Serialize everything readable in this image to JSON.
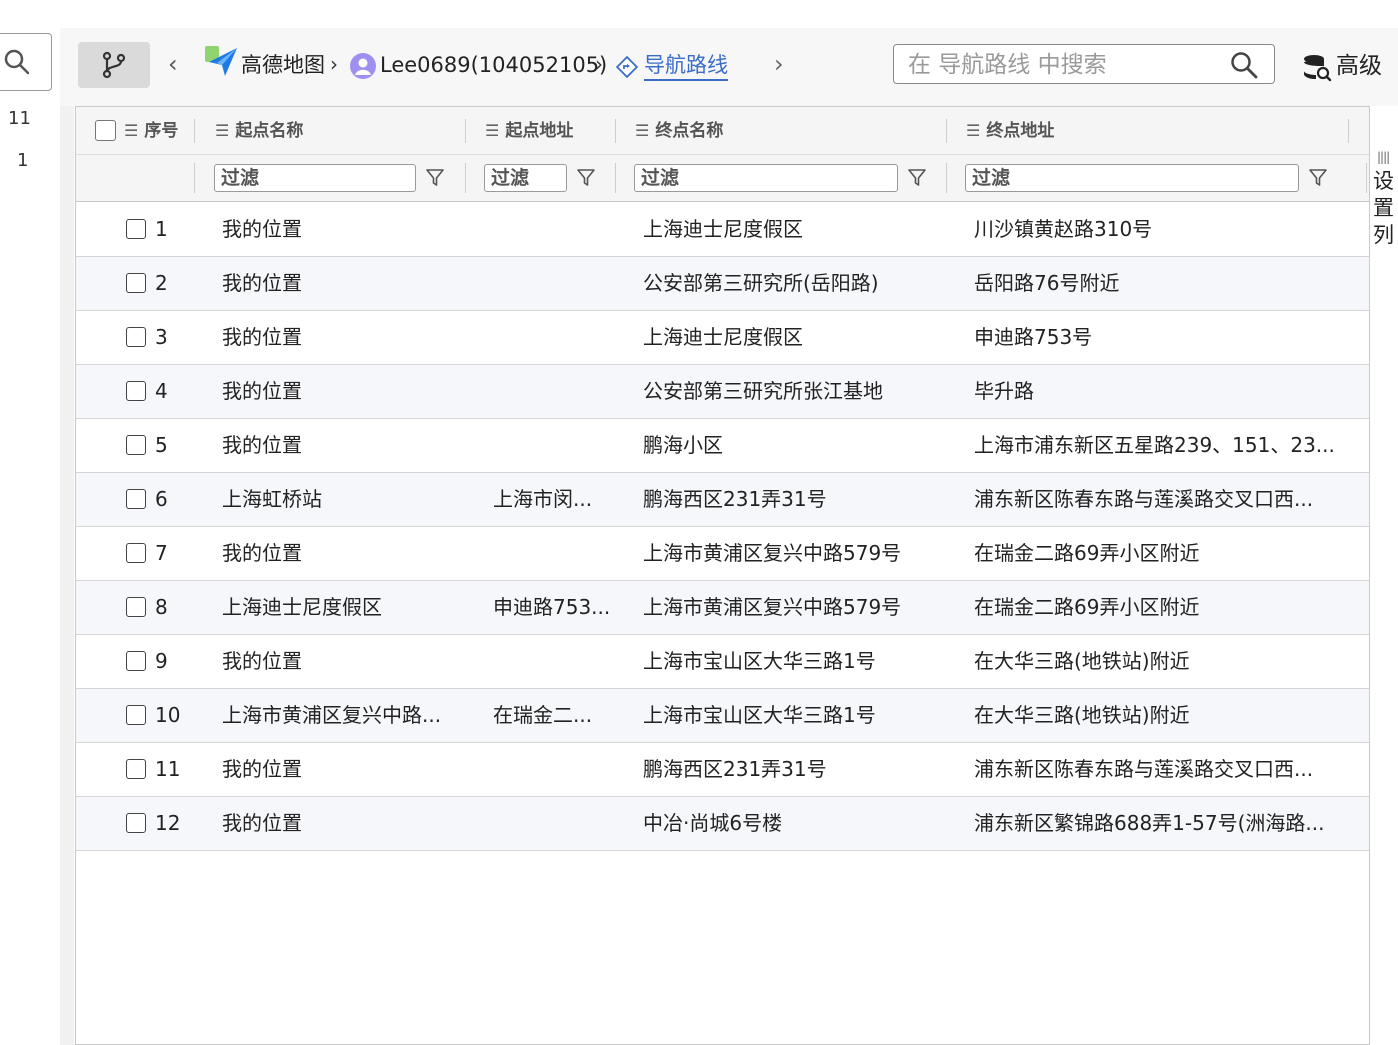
{
  "left_strip": {
    "num_1": "11",
    "num_2": "1"
  },
  "breadcrumb": {
    "app": "高德地图",
    "user": "Lee0689(104052105)",
    "current": "导航路线",
    "sep": "›"
  },
  "nav": {
    "back": "‹",
    "forward": "›"
  },
  "search": {
    "placeholder": "在 导航路线 中搜索"
  },
  "advanced": {
    "label": "高级"
  },
  "settings": {
    "label": "设置列",
    "grip": "||||"
  },
  "columns": {
    "seq": "序号",
    "start_name": "起点名称",
    "start_addr": "起点地址",
    "end_name": "终点名称",
    "end_addr": "终点地址"
  },
  "filter": {
    "placeholder": "过滤"
  },
  "rows": [
    {
      "seq": "1",
      "start_name": "我的位置",
      "start_addr": "",
      "end_name": "上海迪士尼度假区",
      "end_addr": "川沙镇黄赵路310号"
    },
    {
      "seq": "2",
      "start_name": "我的位置",
      "start_addr": "",
      "end_name": "公安部第三研究所(岳阳路)",
      "end_addr": "岳阳路76号附近"
    },
    {
      "seq": "3",
      "start_name": "我的位置",
      "start_addr": "",
      "end_name": "上海迪士尼度假区",
      "end_addr": "申迪路753号"
    },
    {
      "seq": "4",
      "start_name": "我的位置",
      "start_addr": "",
      "end_name": "公安部第三研究所张江基地",
      "end_addr": "毕升路"
    },
    {
      "seq": "5",
      "start_name": "我的位置",
      "start_addr": "",
      "end_name": "鹏海小区",
      "end_addr": "上海市浦东新区五星路239、151、23..."
    },
    {
      "seq": "6",
      "start_name": "上海虹桥站",
      "start_addr": "上海市闵...",
      "end_name": "鹏海西区231弄31号",
      "end_addr": "浦东新区陈春东路与莲溪路交叉口西..."
    },
    {
      "seq": "7",
      "start_name": "我的位置",
      "start_addr": "",
      "end_name": "上海市黄浦区复兴中路579号",
      "end_addr": "在瑞金二路69弄小区附近"
    },
    {
      "seq": "8",
      "start_name": "上海迪士尼度假区",
      "start_addr": "申迪路753...",
      "end_name": "上海市黄浦区复兴中路579号",
      "end_addr": "在瑞金二路69弄小区附近"
    },
    {
      "seq": "9",
      "start_name": "我的位置",
      "start_addr": "",
      "end_name": "上海市宝山区大华三路1号",
      "end_addr": "在大华三路(地铁站)附近"
    },
    {
      "seq": "10",
      "start_name": "上海市黄浦区复兴中路...",
      "start_addr": "在瑞金二...",
      "end_name": "上海市宝山区大华三路1号",
      "end_addr": "在大华三路(地铁站)附近"
    },
    {
      "seq": "11",
      "start_name": "我的位置",
      "start_addr": "",
      "end_name": "鹏海西区231弄31号",
      "end_addr": "浦东新区陈春东路与莲溪路交叉口西..."
    },
    {
      "seq": "12",
      "start_name": "我的位置",
      "start_addr": "",
      "end_name": "中冶·尚城6号楼",
      "end_addr": "浦东新区繁锦路688弄1-57号(洲海路..."
    }
  ],
  "colors": {
    "accent": "#3b6cc8",
    "row_alt": "#f6f7fb",
    "header_bg": "#f5f5f5"
  }
}
